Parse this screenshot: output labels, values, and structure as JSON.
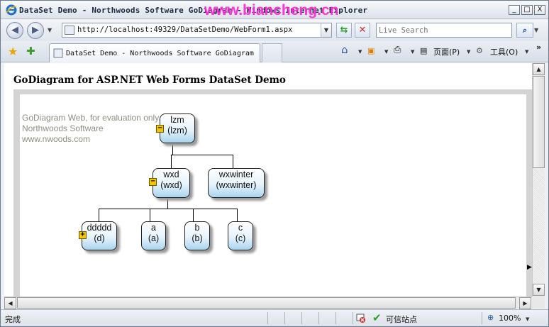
{
  "window": {
    "title": "DataSet Demo - Northwoods Software GoDiagram - Windows Internet Explorer",
    "watermark": "www.biancheng.cn",
    "buttons": [
      "_",
      "□",
      "X"
    ]
  },
  "address_bar": {
    "url": "http://localhost:49329/DataSetDemo/WebForm1.aspx",
    "search_placeholder": "Live Search"
  },
  "tab": {
    "label": "DataSet Demo - Northwoods Software GoDiagram"
  },
  "commands": {
    "page_label": "页面(P)",
    "tools_label": "工具(O)",
    "more": "»"
  },
  "page": {
    "title": "GoDiagram for ASP.NET Web Forms DataSet Demo",
    "evaluation_lines": [
      "GoDiagram Web, for evaluation only.",
      "Northwoods Software",
      "www.nwoods.com"
    ]
  },
  "diagram": {
    "nodes": [
      {
        "id": "lzm",
        "line1": "lzm",
        "line2": "(lzm)",
        "expander": "−"
      },
      {
        "id": "wxd",
        "line1": "wxd",
        "line2": "(wxd)",
        "expander": "−"
      },
      {
        "id": "wxwinter",
        "line1": "wxwinter",
        "line2": "(wxwinter)"
      },
      {
        "id": "ddddd",
        "line1": "ddddd",
        "line2": "(d)",
        "expander": "+"
      },
      {
        "id": "a",
        "line1": "a",
        "line2": "(a)"
      },
      {
        "id": "b",
        "line1": "b",
        "line2": "(b)"
      },
      {
        "id": "c",
        "line1": "c",
        "line2": "(c)"
      }
    ],
    "node_colors": {
      "top": "#ffffff",
      "bottom": "#a9d4ee",
      "border": "#222222"
    },
    "expander_color": "#f2c600"
  },
  "statusbar": {
    "status": "完成",
    "zone": "可信站点",
    "zoom": "100%"
  }
}
